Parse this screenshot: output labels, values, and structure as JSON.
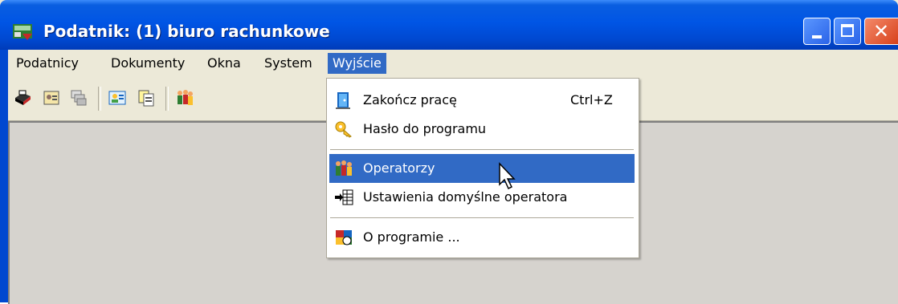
{
  "window": {
    "title": "Podatnik: (1) biuro rachunkowe",
    "close_glyph": "✕"
  },
  "menubar": {
    "items": [
      {
        "label": "Podatnicy"
      },
      {
        "label": "Dokumenty"
      },
      {
        "label": "Okna"
      },
      {
        "label": "System"
      },
      {
        "label": "Wyjście",
        "active": true
      }
    ]
  },
  "toolbar": {
    "icons": [
      "printer-icon",
      "address-card-icon",
      "windows-cascade-icon",
      "user-card-icon",
      "documents-icon",
      "operators-icon"
    ]
  },
  "dropdown": {
    "items": [
      {
        "label": "Zakończ pracę",
        "shortcut": "Ctrl+Z",
        "icon": "exit-door-icon"
      },
      {
        "label": "Hasło do programu",
        "icon": "key-icon"
      },
      {
        "label": "Operatorzy",
        "icon": "operators-icon",
        "highlighted": true
      },
      {
        "label": "Ustawienia domyślne operatora",
        "icon": "settings-table-icon"
      },
      {
        "label": "O programie ...",
        "icon": "about-icon"
      }
    ]
  },
  "colors": {
    "titlebar": "#0055e5",
    "highlight": "#316ac5",
    "face": "#ece9d8"
  }
}
